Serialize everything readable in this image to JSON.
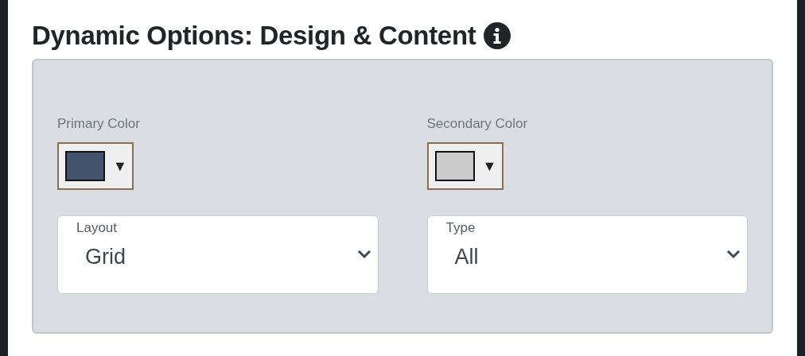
{
  "title": "Dynamic Options: Design & Content",
  "color_pickers": [
    {
      "label": "Primary Color",
      "color": "#43536e",
      "arrow": "▼"
    },
    {
      "label": "Secondary Color",
      "color": "#cbcbcb",
      "arrow": "▼"
    }
  ],
  "selects": [
    {
      "label": "Layout",
      "value": "Grid"
    },
    {
      "label": "Type",
      "value": "All"
    }
  ]
}
